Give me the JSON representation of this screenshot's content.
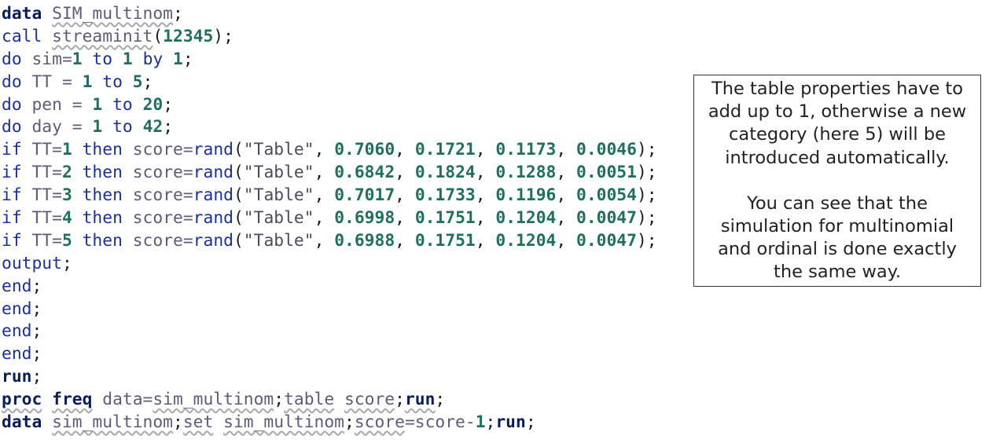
{
  "code_lines": [
    [
      {
        "t": "data",
        "c": "kw-bold"
      },
      {
        "t": " ",
        "c": "punc"
      },
      {
        "t": "SIM_multinom",
        "c": "ds"
      },
      {
        "t": ";",
        "c": "punc"
      }
    ],
    [
      {
        "t": "call",
        "c": "kw"
      },
      {
        "t": " ",
        "c": "punc"
      },
      {
        "t": "streaminit",
        "c": "ds"
      },
      {
        "t": "(",
        "c": "punc"
      },
      {
        "t": "12345",
        "c": "num"
      },
      {
        "t": ");",
        "c": "punc"
      }
    ],
    [
      {
        "t": "do",
        "c": "kw"
      },
      {
        "t": " sim=",
        "c": "var"
      },
      {
        "t": "1",
        "c": "num"
      },
      {
        "t": " ",
        "c": "punc"
      },
      {
        "t": "to",
        "c": "kw"
      },
      {
        "t": " ",
        "c": "punc"
      },
      {
        "t": "1",
        "c": "num"
      },
      {
        "t": " ",
        "c": "punc"
      },
      {
        "t": "by",
        "c": "kw"
      },
      {
        "t": " ",
        "c": "punc"
      },
      {
        "t": "1",
        "c": "num"
      },
      {
        "t": ";",
        "c": "punc"
      }
    ],
    [
      {
        "t": "do",
        "c": "kw"
      },
      {
        "t": " TT = ",
        "c": "var"
      },
      {
        "t": "1",
        "c": "num"
      },
      {
        "t": " ",
        "c": "punc"
      },
      {
        "t": "to",
        "c": "kw"
      },
      {
        "t": " ",
        "c": "punc"
      },
      {
        "t": "5",
        "c": "num"
      },
      {
        "t": ";",
        "c": "punc"
      }
    ],
    [
      {
        "t": "do",
        "c": "kw"
      },
      {
        "t": " pen = ",
        "c": "var"
      },
      {
        "t": "1",
        "c": "num"
      },
      {
        "t": " ",
        "c": "punc"
      },
      {
        "t": "to",
        "c": "kw"
      },
      {
        "t": " ",
        "c": "punc"
      },
      {
        "t": "20",
        "c": "num"
      },
      {
        "t": ";",
        "c": "punc"
      }
    ],
    [
      {
        "t": "do",
        "c": "kw"
      },
      {
        "t": " day = ",
        "c": "var"
      },
      {
        "t": "1",
        "c": "num"
      },
      {
        "t": " ",
        "c": "punc"
      },
      {
        "t": "to",
        "c": "kw"
      },
      {
        "t": " ",
        "c": "punc"
      },
      {
        "t": "42",
        "c": "num"
      },
      {
        "t": ";",
        "c": "punc"
      }
    ],
    [
      {
        "t": "if",
        "c": "kw"
      },
      {
        "t": " TT=",
        "c": "var"
      },
      {
        "t": "1",
        "c": "num"
      },
      {
        "t": " ",
        "c": "punc"
      },
      {
        "t": "then",
        "c": "kw"
      },
      {
        "t": " score=",
        "c": "var"
      },
      {
        "t": "rand",
        "c": "kw"
      },
      {
        "t": "(",
        "c": "punc"
      },
      {
        "t": "\"Table\"",
        "c": "str"
      },
      {
        "t": ", ",
        "c": "punc"
      },
      {
        "t": "0.7060",
        "c": "num"
      },
      {
        "t": ", ",
        "c": "punc"
      },
      {
        "t": "0.1721",
        "c": "num"
      },
      {
        "t": ", ",
        "c": "punc"
      },
      {
        "t": "0.1173",
        "c": "num"
      },
      {
        "t": ", ",
        "c": "punc"
      },
      {
        "t": "0.0046",
        "c": "num"
      },
      {
        "t": ");",
        "c": "punc"
      }
    ],
    [
      {
        "t": "if",
        "c": "kw"
      },
      {
        "t": " TT=",
        "c": "var"
      },
      {
        "t": "2",
        "c": "num"
      },
      {
        "t": " ",
        "c": "punc"
      },
      {
        "t": "then",
        "c": "kw"
      },
      {
        "t": " score=",
        "c": "var"
      },
      {
        "t": "rand",
        "c": "kw"
      },
      {
        "t": "(",
        "c": "punc"
      },
      {
        "t": "\"Table\"",
        "c": "str"
      },
      {
        "t": ", ",
        "c": "punc"
      },
      {
        "t": "0.6842",
        "c": "num"
      },
      {
        "t": ", ",
        "c": "punc"
      },
      {
        "t": "0.1824",
        "c": "num"
      },
      {
        "t": ", ",
        "c": "punc"
      },
      {
        "t": "0.1288",
        "c": "num"
      },
      {
        "t": ", ",
        "c": "punc"
      },
      {
        "t": "0.0051",
        "c": "num"
      },
      {
        "t": ");",
        "c": "punc"
      }
    ],
    [
      {
        "t": "if",
        "c": "kw"
      },
      {
        "t": " TT=",
        "c": "var"
      },
      {
        "t": "3",
        "c": "num"
      },
      {
        "t": " ",
        "c": "punc"
      },
      {
        "t": "then",
        "c": "kw"
      },
      {
        "t": " score=",
        "c": "var"
      },
      {
        "t": "rand",
        "c": "kw"
      },
      {
        "t": "(",
        "c": "punc"
      },
      {
        "t": "\"Table\"",
        "c": "str"
      },
      {
        "t": ", ",
        "c": "punc"
      },
      {
        "t": "0.7017",
        "c": "num"
      },
      {
        "t": ", ",
        "c": "punc"
      },
      {
        "t": "0.1733",
        "c": "num"
      },
      {
        "t": ", ",
        "c": "punc"
      },
      {
        "t": "0.1196",
        "c": "num"
      },
      {
        "t": ", ",
        "c": "punc"
      },
      {
        "t": "0.0054",
        "c": "num"
      },
      {
        "t": ");",
        "c": "punc"
      }
    ],
    [
      {
        "t": "if",
        "c": "kw"
      },
      {
        "t": " TT=",
        "c": "var"
      },
      {
        "t": "4",
        "c": "num"
      },
      {
        "t": " ",
        "c": "punc"
      },
      {
        "t": "then",
        "c": "kw"
      },
      {
        "t": " score=",
        "c": "var"
      },
      {
        "t": "rand",
        "c": "kw"
      },
      {
        "t": "(",
        "c": "punc"
      },
      {
        "t": "\"Table\"",
        "c": "str"
      },
      {
        "t": ", ",
        "c": "punc"
      },
      {
        "t": "0.6998",
        "c": "num"
      },
      {
        "t": ", ",
        "c": "punc"
      },
      {
        "t": "0.1751",
        "c": "num"
      },
      {
        "t": ", ",
        "c": "punc"
      },
      {
        "t": "0.1204",
        "c": "num"
      },
      {
        "t": ", ",
        "c": "punc"
      },
      {
        "t": "0.0047",
        "c": "num"
      },
      {
        "t": ");",
        "c": "punc"
      }
    ],
    [
      {
        "t": "if",
        "c": "kw"
      },
      {
        "t": " TT=",
        "c": "var"
      },
      {
        "t": "5",
        "c": "num"
      },
      {
        "t": " ",
        "c": "punc"
      },
      {
        "t": "then",
        "c": "kw"
      },
      {
        "t": " score=",
        "c": "var"
      },
      {
        "t": "rand",
        "c": "kw"
      },
      {
        "t": "(",
        "c": "punc"
      },
      {
        "t": "\"Table\"",
        "c": "str"
      },
      {
        "t": ", ",
        "c": "punc"
      },
      {
        "t": "0.6988",
        "c": "num"
      },
      {
        "t": ", ",
        "c": "punc"
      },
      {
        "t": "0.1751",
        "c": "num"
      },
      {
        "t": ", ",
        "c": "punc"
      },
      {
        "t": "0.1204",
        "c": "num"
      },
      {
        "t": ", ",
        "c": "punc"
      },
      {
        "t": "0.0047",
        "c": "num"
      },
      {
        "t": ");",
        "c": "punc"
      }
    ],
    [
      {
        "t": "output",
        "c": "kw"
      },
      {
        "t": ";",
        "c": "punc"
      }
    ],
    [
      {
        "t": "end",
        "c": "kw"
      },
      {
        "t": ";",
        "c": "punc"
      }
    ],
    [
      {
        "t": "end",
        "c": "kw"
      },
      {
        "t": ";",
        "c": "punc"
      }
    ],
    [
      {
        "t": "end",
        "c": "kw"
      },
      {
        "t": ";",
        "c": "punc"
      }
    ],
    [
      {
        "t": "end",
        "c": "kw"
      },
      {
        "t": ";",
        "c": "punc"
      }
    ],
    [
      {
        "t": "run",
        "c": "kw-bold"
      },
      {
        "t": ";",
        "c": "punc"
      }
    ],
    [
      {
        "t": "proc",
        "c": "kw-bold ul"
      },
      {
        "t": " ",
        "c": "punc"
      },
      {
        "t": "freq",
        "c": "kw-bold ul"
      },
      {
        "t": " data=",
        "c": "var"
      },
      {
        "t": "sim_multinom",
        "c": "ds"
      },
      {
        "t": ";",
        "c": "punc"
      },
      {
        "t": "table",
        "c": "ds"
      },
      {
        "t": " ",
        "c": "punc"
      },
      {
        "t": "score",
        "c": "ds"
      },
      {
        "t": ";",
        "c": "punc"
      },
      {
        "t": "run",
        "c": "kw-bold ul"
      },
      {
        "t": ";",
        "c": "punc"
      }
    ],
    [
      {
        "t": "data",
        "c": "kw-bold"
      },
      {
        "t": " ",
        "c": "punc"
      },
      {
        "t": "sim_multinom",
        "c": "ds"
      },
      {
        "t": ";",
        "c": "punc"
      },
      {
        "t": "set",
        "c": "ds"
      },
      {
        "t": " ",
        "c": "punc"
      },
      {
        "t": "sim_multinom",
        "c": "ds"
      },
      {
        "t": ";",
        "c": "punc"
      },
      {
        "t": "score",
        "c": "ds"
      },
      {
        "t": "=score-",
        "c": "var"
      },
      {
        "t": "1",
        "c": "num"
      },
      {
        "t": ";",
        "c": "punc"
      },
      {
        "t": "run",
        "c": "kw-bold"
      },
      {
        "t": ";",
        "c": "punc"
      }
    ]
  ],
  "note": {
    "paragraph_1": [
      "The table properties have to",
      "add up to 1, otherwise a new",
      "category (here 5) will be",
      "introduced automatically."
    ],
    "paragraph_2": [
      "You can see that the",
      "simulation for multinomial",
      "and ordinal is done exactly",
      "the same way."
    ]
  }
}
